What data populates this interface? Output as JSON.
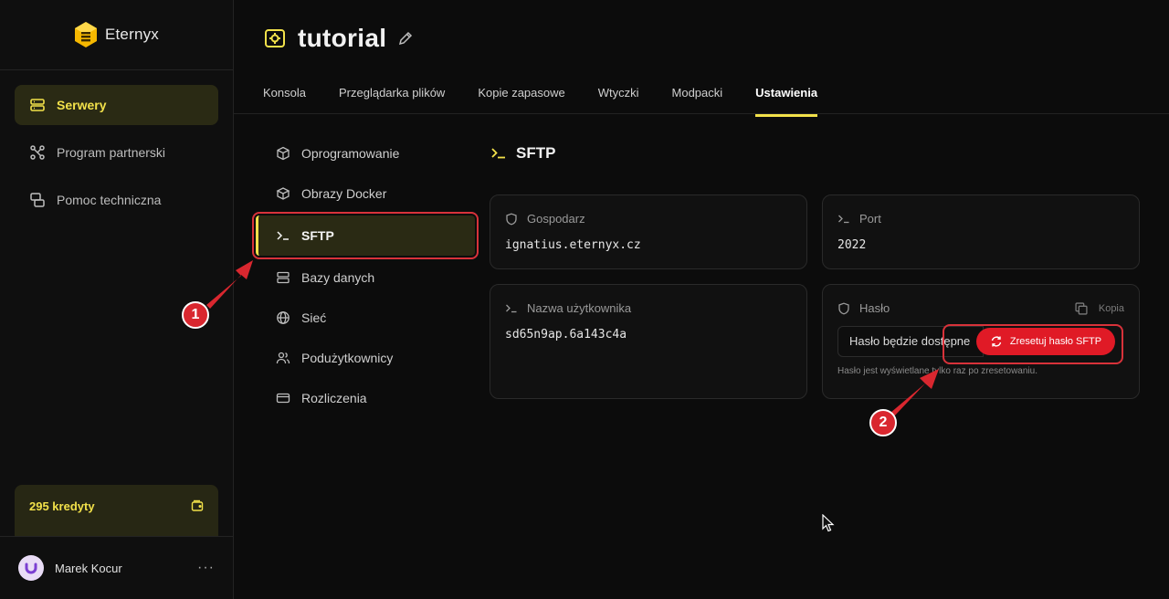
{
  "app": {
    "brand": "Eternyx",
    "accent": "#f2e14a",
    "annotation_color": "#d9272f"
  },
  "sidebar": {
    "items": [
      {
        "label": "Serwery",
        "icon": "server-icon",
        "active": true
      },
      {
        "label": "Program partnerski",
        "icon": "network-icon",
        "active": false
      },
      {
        "label": "Pomoc techniczna",
        "icon": "support-icon",
        "active": false
      }
    ],
    "credits": "295 kredyty",
    "user": {
      "name": "Marek Kocur",
      "menu": "···"
    }
  },
  "header": {
    "title": "tutorial",
    "tabs": [
      {
        "label": "Konsola",
        "active": false
      },
      {
        "label": "Przeglądarka plików",
        "active": false
      },
      {
        "label": "Kopie zapasowe",
        "active": false
      },
      {
        "label": "Wtyczki",
        "active": false
      },
      {
        "label": "Modpacki",
        "active": false
      },
      {
        "label": "Ustawienia",
        "active": true
      }
    ]
  },
  "submenu": {
    "items": [
      {
        "label": "Oprogramowanie",
        "icon": "cube-icon"
      },
      {
        "label": "Obrazy Docker",
        "icon": "box-icon"
      },
      {
        "label": "SFTP",
        "icon": "terminal-icon",
        "active": true
      },
      {
        "label": "Bazy danych",
        "icon": "database-icon"
      },
      {
        "label": "Sieć",
        "icon": "globe-icon"
      },
      {
        "label": "Podużytkownicy",
        "icon": "users-icon"
      },
      {
        "label": "Rozliczenia",
        "icon": "card-icon"
      }
    ]
  },
  "sftp": {
    "title": "SFTP",
    "host_label": "Gospodarz",
    "host_value": "ignatius.eternyx.cz",
    "port_label": "Port",
    "port_value": "2022",
    "username_label": "Nazwa użytkownika",
    "username_value": "sd65n9ap.6a143c4a",
    "password_label": "Hasło",
    "copy_label": "Kopia",
    "password_value": "Hasło będzie dostępne",
    "reset_button": "Zresetuj hasło SFTP",
    "hint": "Hasło jest wyświetlane tylko raz po zresetowaniu."
  },
  "annotations": {
    "badge_1": "1",
    "badge_2": "2"
  }
}
